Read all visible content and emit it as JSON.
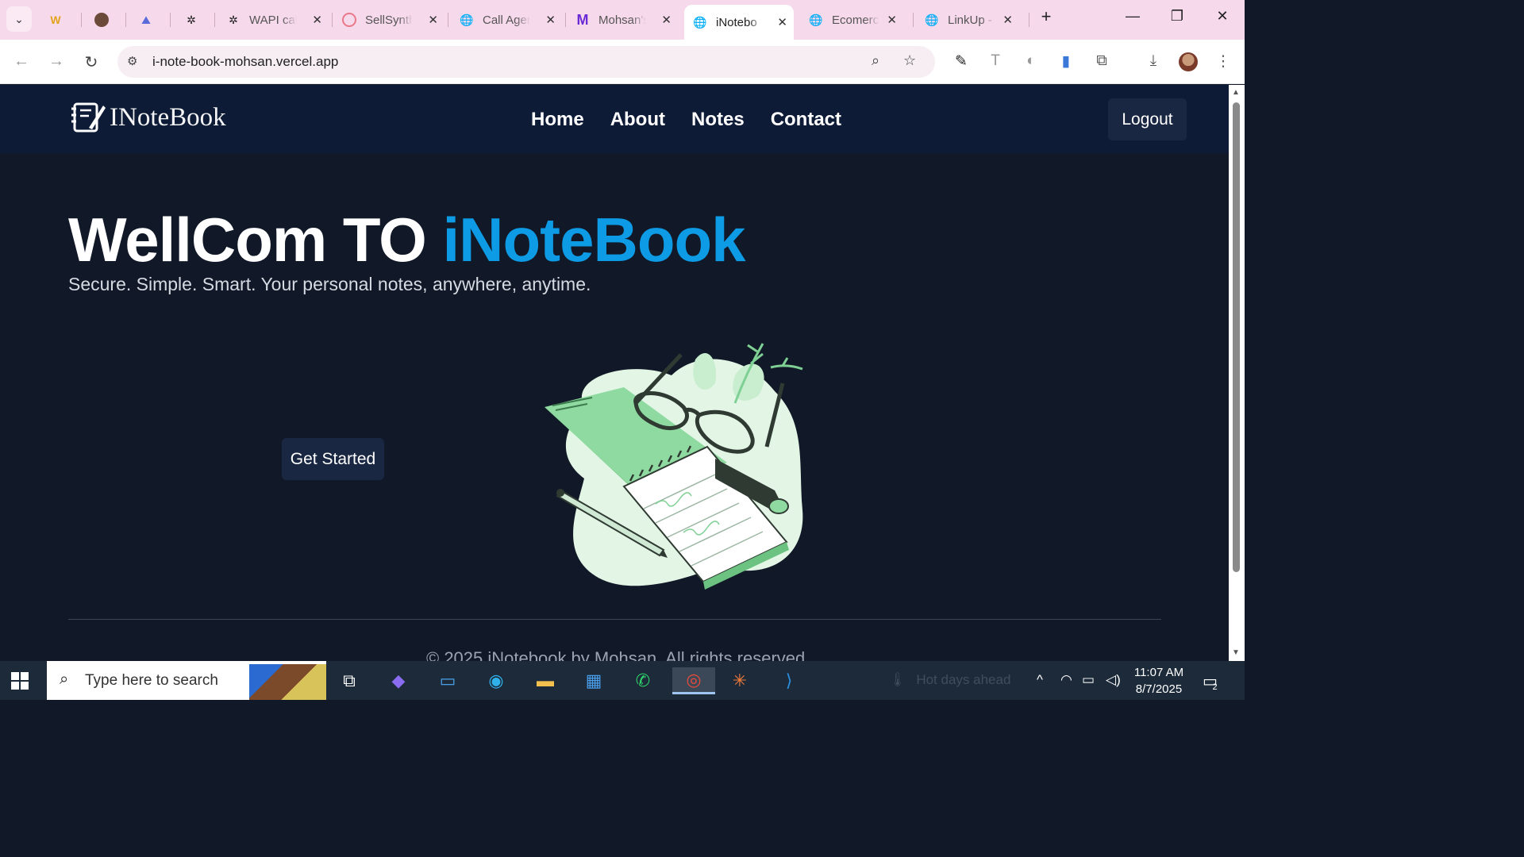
{
  "browser": {
    "tabs": [
      {
        "label": "",
        "icon": "w-logo-icon"
      },
      {
        "label": "",
        "icon": "avatar-icon"
      },
      {
        "label": "",
        "icon": "mountain-icon"
      },
      {
        "label": "",
        "icon": "openai-icon"
      },
      {
        "label": "WAPI call",
        "icon": "openai-icon"
      },
      {
        "label": "SellSynth",
        "icon": "sellsynth-icon"
      },
      {
        "label": "Call Agen",
        "icon": "globe-icon"
      },
      {
        "label": "Mohsan's",
        "icon": "m-logo-icon"
      },
      {
        "label": "iNotebo",
        "icon": "globe-icon",
        "active": true
      },
      {
        "label": "Ecomerc",
        "icon": "globe-icon"
      },
      {
        "label": "LinkUp -",
        "icon": "globe-icon"
      }
    ],
    "url": "i-note-book-mohsan.vercel.app",
    "tab_close_glyph": "✕",
    "new_tab_glyph": "+"
  },
  "navbar": {
    "brand": "INoteBook",
    "links": [
      "Home",
      "About",
      "Notes",
      "Contact"
    ],
    "logout_label": "Logout"
  },
  "hero": {
    "title_white": "WellCom TO",
    "title_accent": "iNoteBook",
    "subtitle": "Secure. Simple. Smart. Your personal notes, anywhere, anytime.",
    "cta_label": "Get Started"
  },
  "footer": {
    "text": "© 2025 iNotebook by Mohsan. All rights reserved."
  },
  "taskbar": {
    "search_placeholder": "Type here to search",
    "weather": "Hot days ahead",
    "time": "11:07 AM",
    "date": "8/7/2025",
    "notification_count": "2"
  },
  "colors": {
    "accent": "#0d9be6",
    "page_bg": "#111827",
    "navbar_bg": "#0d1b36",
    "button_bg": "#1a2742",
    "tabbar_bg": "#f7d9ec"
  }
}
